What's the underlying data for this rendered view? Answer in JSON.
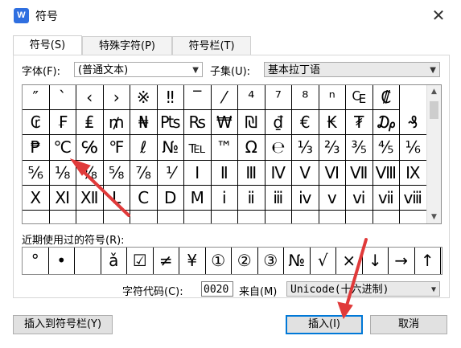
{
  "window": {
    "icon_letter": "W",
    "title": "符号",
    "close_glyph": "✕"
  },
  "tabs": [
    "符号(S)",
    "特殊字符(P)",
    "符号栏(T)"
  ],
  "font": {
    "label": "字体(F):",
    "value": "(普通文本)"
  },
  "subset": {
    "label": "子集(U):",
    "value": "基本拉丁语"
  },
  "symbol_grid": [
    [
      "″",
      "ˋ",
      "‹",
      "›",
      "※",
      "‼",
      "‾",
      "⁄",
      "⁴",
      "⁷",
      "⁸",
      "ⁿ",
      "₠",
      "₡"
    ],
    [
      "₢",
      "₣",
      "₤",
      "₥",
      "₦",
      "₧",
      "₨",
      "₩",
      "₪",
      "₫",
      "€",
      "₭",
      "₮",
      "₯",
      "₰"
    ],
    [
      "₱",
      "℃",
      "℅",
      "℉",
      "ℓ",
      "№",
      "℡",
      "™",
      "Ω",
      "℮",
      "⅓",
      "⅔",
      "⅗",
      "⅘",
      "⅙"
    ],
    [
      "⅚",
      "⅛",
      "⅜",
      "⅝",
      "⅞",
      "⅟",
      "Ⅰ",
      "Ⅱ",
      "Ⅲ",
      "Ⅳ",
      "Ⅴ",
      "Ⅵ",
      "Ⅶ",
      "Ⅷ",
      "Ⅸ"
    ],
    [
      "Ⅹ",
      "Ⅺ",
      "Ⅻ",
      "Ⅼ",
      "Ⅽ",
      "Ⅾ",
      "Ⅿ",
      "ⅰ",
      "ⅱ",
      "ⅲ",
      "ⅳ",
      "ⅴ",
      "ⅵ",
      "ⅶ",
      "ⅷ"
    ],
    [
      "",
      "",
      "",
      "",
      "",
      "",
      "",
      "",
      "",
      "",
      "",
      "",
      "",
      "",
      ""
    ]
  ],
  "recent": {
    "label": "近期使用过的符号(R):",
    "symbols": [
      "°",
      "•",
      "",
      "ǎ",
      "☑",
      "≠",
      "¥",
      "①",
      "②",
      "③",
      "№",
      "√",
      "×",
      "↓",
      "→",
      "↑"
    ]
  },
  "char_code": {
    "label": "字符代码(C):",
    "value": "0020",
    "from_label": "来自(M)",
    "from_value": "Unicode(十六进制)"
  },
  "buttons": {
    "insert_to_bar": "插入到符号栏(Y)",
    "insert": "插入(I)",
    "cancel": "取消"
  },
  "colors": {
    "accent": "#0078d7",
    "annotation_arrow": "#e03a3a"
  }
}
